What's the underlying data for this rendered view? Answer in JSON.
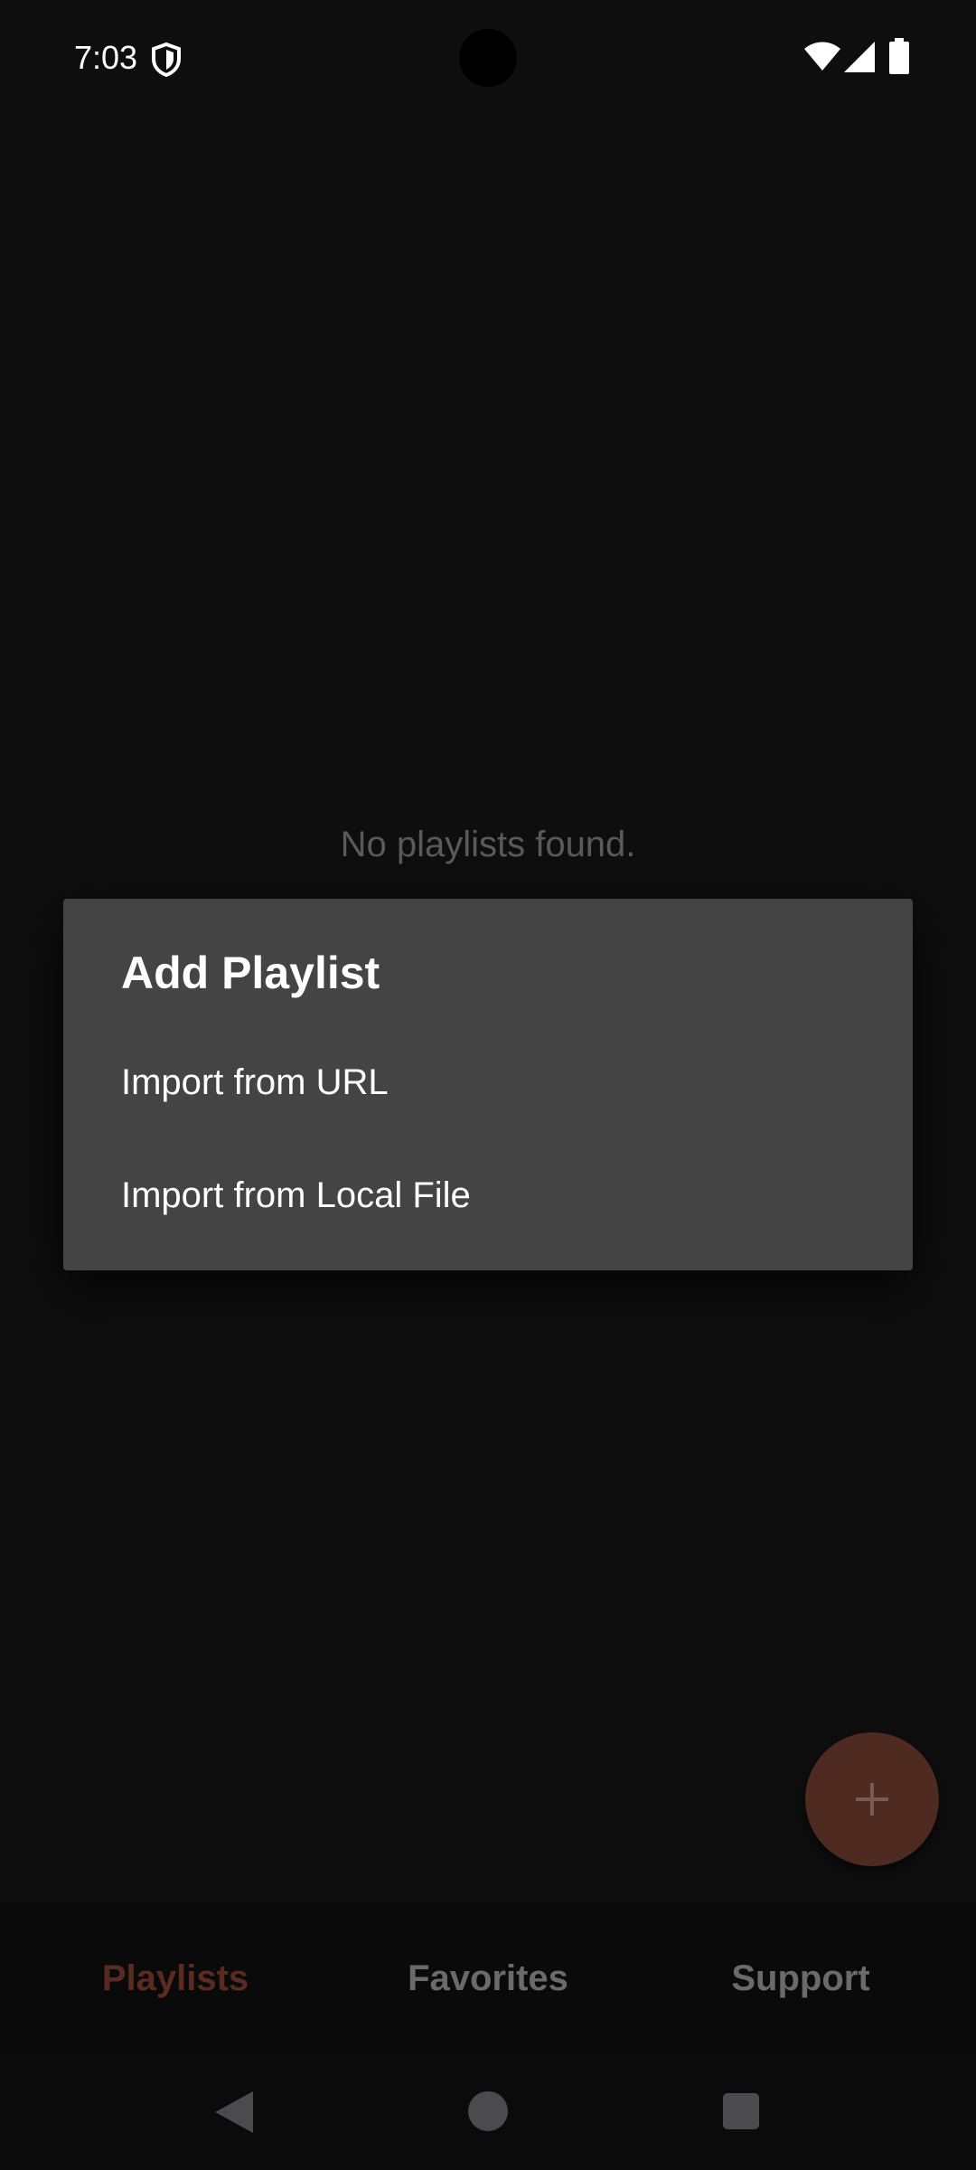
{
  "status_bar": {
    "time": "7:03",
    "icons": [
      "shield-icon",
      "wifi-icon",
      "signal-icon",
      "battery-icon"
    ]
  },
  "main": {
    "empty_message": "No playlists found."
  },
  "fab": {
    "icon": "plus-icon"
  },
  "dialog": {
    "title": "Add Playlist",
    "options": [
      {
        "label": "Import from URL"
      },
      {
        "label": "Import from Local File"
      }
    ]
  },
  "bottom_nav": {
    "items": [
      {
        "label": "Playlists",
        "selected": true
      },
      {
        "label": "Favorites",
        "selected": false
      },
      {
        "label": "Support",
        "selected": false
      }
    ]
  },
  "system_nav": {
    "icons": [
      "back-icon",
      "home-icon",
      "recents-icon"
    ]
  },
  "colors": {
    "background": "#0e0e0e",
    "dialog": "#444444",
    "accent": "#5a2c20",
    "fab": "#4e2a20",
    "inactive": "#6a6a6a"
  }
}
